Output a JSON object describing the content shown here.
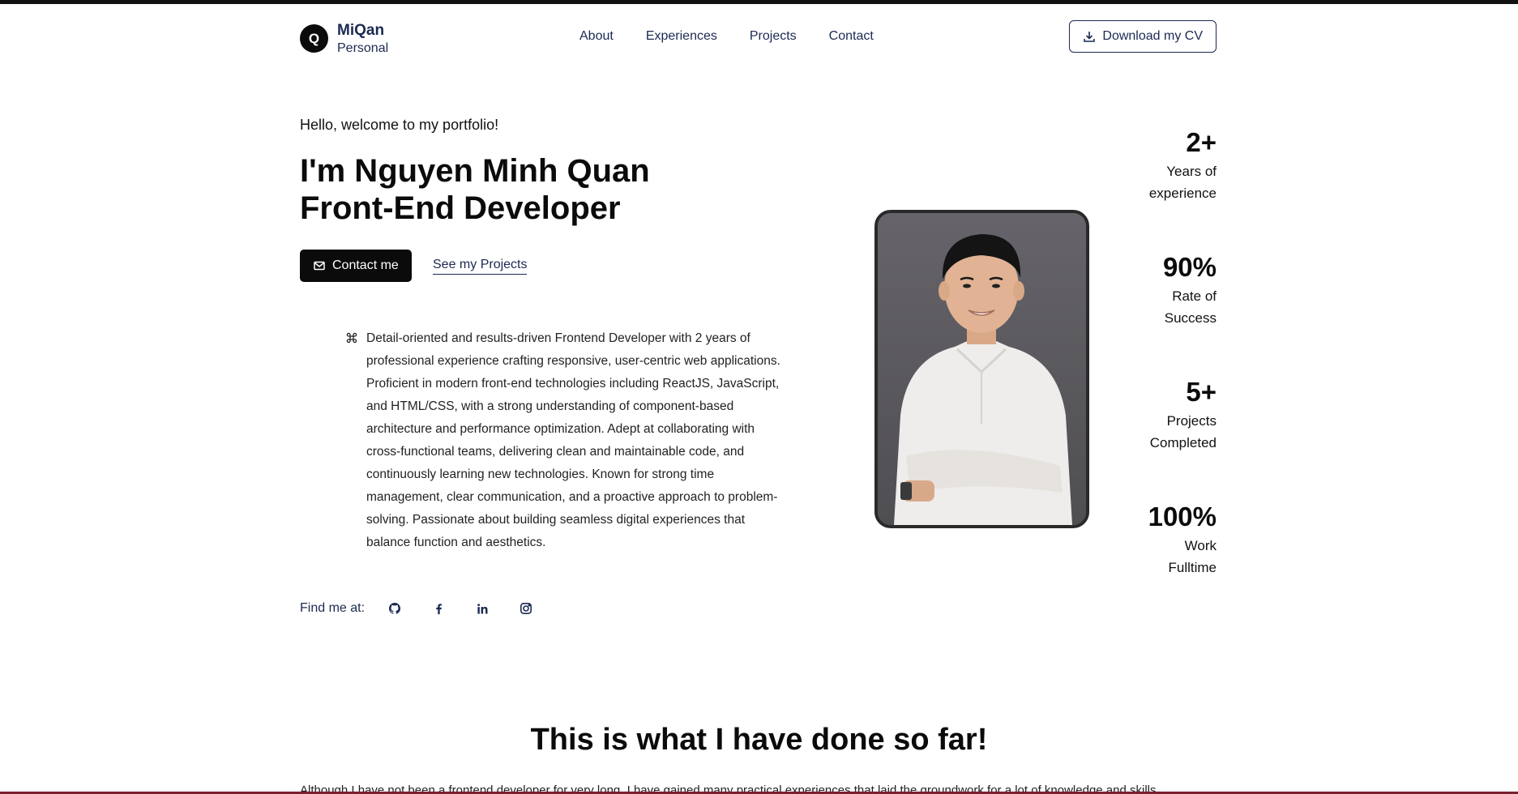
{
  "brand": {
    "logo_letter": "Q",
    "name": "MiQan",
    "subtitle": "Personal"
  },
  "nav": {
    "items": [
      "About",
      "Experiences",
      "Projects",
      "Contact"
    ]
  },
  "header": {
    "cv_label": "Download my CV"
  },
  "hero": {
    "greeting": "Hello, welcome to my portfolio!",
    "title_line1": "I'm Nguyen Minh Quan",
    "title_line2": "Front-End Developer",
    "contact_label": "Contact me",
    "projects_label": "See my Projects",
    "bio": "Detail-oriented and results-driven Frontend Developer with 2 years of professional experience crafting responsive, user-centric web applications. Proficient in modern front-end technologies including ReactJS, JavaScript, and HTML/CSS, with a strong understanding of component-based architecture and performance optimization. Adept at collaborating with cross-functional teams, delivering clean and maintainable code, and continuously learning new technologies. Known for strong time management, clear communication, and a proactive approach to problem-solving. Passionate about building seamless digital experiences that balance function and aesthetics."
  },
  "find": {
    "label": "Find me at:",
    "icons": [
      "github-icon",
      "facebook-icon",
      "linkedin-icon",
      "instagram-icon"
    ]
  },
  "stats": [
    {
      "value": "2+",
      "label1": "Years of",
      "label2": "experience"
    },
    {
      "value": "90%",
      "label1": "Rate of",
      "label2": "Success"
    },
    {
      "value": "5+",
      "label1": "Projects",
      "label2": "Completed"
    },
    {
      "value": "100%",
      "label1": "Work",
      "label2": "Fulltime"
    }
  ],
  "section": {
    "title": "This is what I have done so far!",
    "intro_partial": "Although I have not been a frontend developer for very long, I have gained many practical experiences that laid the groundwork for a lot of knowledge and skills"
  },
  "colors": {
    "navy": "#1c2a52",
    "black": "#0b0b0b",
    "photo_bg": "#5c5a5e"
  }
}
